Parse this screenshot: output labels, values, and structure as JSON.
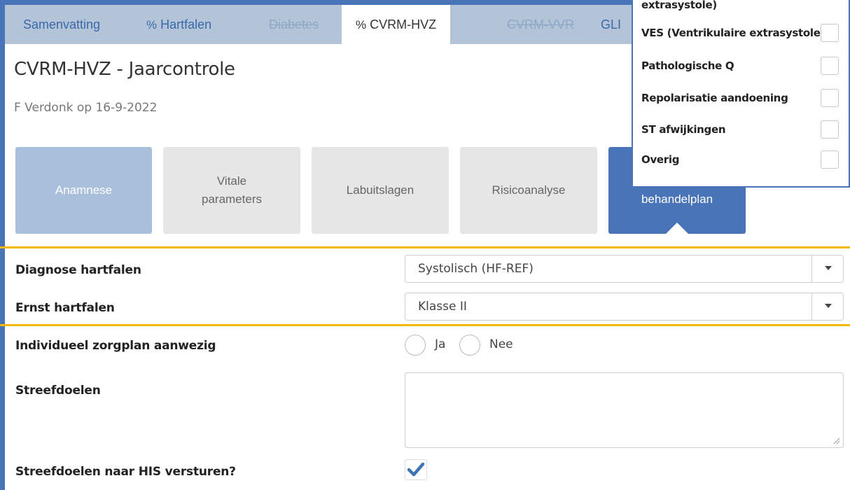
{
  "tabs": [
    {
      "label": "Samenvatting",
      "icon": "",
      "state": "normal"
    },
    {
      "label": "Hartfalen",
      "icon": "link-icon",
      "state": "normal"
    },
    {
      "label": "Diabetes",
      "icon": "",
      "state": "disabled"
    },
    {
      "label": "CVRM-HVZ",
      "icon": "link-icon",
      "state": "active"
    },
    {
      "label": "CVRM-VVR",
      "icon": "",
      "state": "disabled"
    },
    {
      "label": "GLI",
      "icon": "",
      "state": "normal"
    }
  ],
  "header": {
    "title": "CVRM-HVZ - Jaarcontrole",
    "subtitle": "F Verdonk op 16-9-2022"
  },
  "steps": [
    {
      "label": "Anamnese",
      "state": "done"
    },
    {
      "label": "Vitale parameters",
      "state": "normal"
    },
    {
      "label": "Labuitslagen",
      "state": "normal"
    },
    {
      "label": "Risicoanalyse",
      "state": "normal"
    },
    {
      "label": "behandelplan",
      "state": "current"
    }
  ],
  "form": {
    "diagnose_label": "Diagnose hartfalen",
    "diagnose_value": "Systolisch (HF-REF)",
    "ernst_label": "Ernst hartfalen",
    "ernst_value": "Klasse II",
    "zorgplan_label": "Individueel zorgplan aanwezig",
    "radio_ja": "Ja",
    "radio_nee": "Nee",
    "streefdoelen_label": "Streefdoelen",
    "streefdoelen_value": "",
    "his_label": "Streefdoelen naar HIS versturen?",
    "his_checked": true
  },
  "popup": {
    "header_partial": "extrasystole)",
    "items": [
      {
        "label": "VES (Ventrikulaire extrasystole)",
        "checked": false
      },
      {
        "label": "Pathologische Q",
        "checked": false
      },
      {
        "label": "Repolarisatie aandoening",
        "checked": false
      },
      {
        "label": "ST afwijkingen",
        "checked": false
      },
      {
        "label": "Overig",
        "checked": false
      }
    ]
  },
  "colors": {
    "accent": "#4a74b8",
    "tabbar": "#b3c4d9",
    "highlight": "#f5b800",
    "check": "#3f74b5"
  }
}
